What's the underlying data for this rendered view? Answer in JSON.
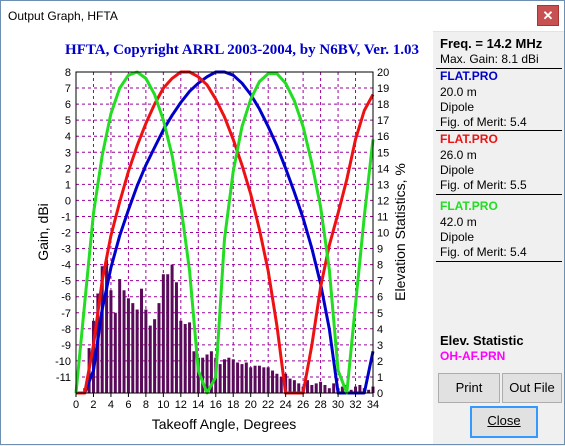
{
  "window": {
    "title": "Output Graph, HFTA"
  },
  "chart_data": {
    "type": "line",
    "title": "HFTA, Copyright ARRL 2003-2004, by N6BV, Ver. 1.03",
    "xlabel": "Takeoff Angle, Degrees",
    "ylabel": "Gain, dBi",
    "y2label": "Elevation Statistics, %",
    "xlim": [
      0,
      34
    ],
    "ylim": [
      -12,
      8
    ],
    "y2lim": [
      0,
      20
    ],
    "xticks": [
      0,
      2,
      4,
      6,
      8,
      10,
      12,
      14,
      16,
      18,
      20,
      22,
      24,
      26,
      28,
      30,
      32,
      34
    ],
    "yticks": [
      8,
      7,
      6,
      5,
      4,
      3,
      2,
      1,
      0,
      -1,
      -2,
      -3,
      -4,
      -5,
      -6,
      -7,
      -8,
      -9,
      -10,
      -11
    ],
    "y2ticks": [
      20,
      19,
      18,
      17,
      16,
      15,
      14,
      13,
      12,
      11,
      10,
      9,
      8,
      7,
      6,
      5,
      4,
      3,
      2,
      1,
      0
    ],
    "grid": true,
    "series": [
      {
        "name": "FLAT.PRO 20.0 m Dipole",
        "color": "#0000cc",
        "x": [
          0,
          1,
          2,
          3,
          4,
          5,
          6,
          7,
          8,
          9,
          10,
          11,
          12,
          13,
          14,
          15,
          16,
          17,
          18,
          19,
          20,
          21,
          22,
          23,
          24,
          25,
          26,
          27,
          28,
          29,
          30,
          31,
          32,
          33,
          34
        ],
        "y": [
          -12,
          -12,
          -10.6,
          -6.8,
          -4.2,
          -2.2,
          -0.6,
          0.9,
          2.2,
          3.3,
          4.4,
          5.3,
          6.1,
          6.8,
          7.3,
          7.7,
          8,
          8,
          7.8,
          7.3,
          6.6,
          5.7,
          4.6,
          3.4,
          2,
          0.5,
          -1.1,
          -3,
          -5.2,
          -8,
          -12,
          -12,
          -12,
          -12,
          -9.4
        ]
      },
      {
        "name": "FLAT.PRO 26.0 m Dipole",
        "color": "#ee1111",
        "x": [
          0,
          1,
          2,
          3,
          4,
          5,
          6,
          7,
          8,
          9,
          10,
          11,
          12,
          13,
          14,
          15,
          16,
          17,
          18,
          19,
          20,
          21,
          22,
          23,
          24,
          25,
          26,
          27,
          28,
          29,
          30,
          31,
          32,
          33,
          34
        ],
        "y": [
          -12,
          -12,
          -9,
          -5,
          -2.2,
          -0.1,
          1.8,
          3.4,
          4.8,
          6,
          7,
          7.6,
          8,
          8,
          7.7,
          7.2,
          6.3,
          5.2,
          3.8,
          2.2,
          0.4,
          -1.8,
          -4.4,
          -7.8,
          -12,
          -12,
          -12,
          -9,
          -5.4,
          -2.8,
          -0.8,
          1.3,
          3.8,
          5.6,
          6.6
        ]
      },
      {
        "name": "FLAT.PRO 42.0 m Dipole",
        "color": "#22dd22",
        "x": [
          0,
          1,
          2,
          3,
          4,
          5,
          6,
          7,
          8,
          9,
          10,
          11,
          12,
          13,
          14,
          15,
          16,
          17,
          18,
          19,
          20,
          21,
          22,
          23,
          24,
          25,
          26,
          27,
          28,
          29,
          30,
          31,
          32,
          33,
          34
        ],
        "y": [
          -12,
          -6.4,
          -0.8,
          2.8,
          5.4,
          7,
          7.8,
          8,
          7.6,
          6.6,
          5,
          2.8,
          -0.3,
          -4.4,
          -10.6,
          -12,
          -11,
          -2.4,
          1.8,
          4.6,
          6.3,
          7.4,
          7.9,
          7.9,
          7.3,
          6.2,
          4.6,
          2.3,
          -0.4,
          -4.3,
          -10.6,
          -12,
          -6.5,
          -1,
          3.8
        ]
      }
    ],
    "bars": {
      "name": "Elevation Statistics",
      "color": "#5a0a5a",
      "x": [
        1,
        1.5,
        2,
        2.5,
        3,
        3.5,
        4,
        4.5,
        5,
        5.5,
        6,
        6.5,
        7,
        7.5,
        8,
        8.5,
        9,
        9.5,
        10,
        10.5,
        11,
        11.5,
        12,
        12.5,
        13,
        13.5,
        14,
        14.5,
        15,
        15.5,
        16,
        16.5,
        17,
        17.5,
        18,
        18.5,
        19,
        19.5,
        20,
        20.5,
        21,
        21.5,
        22,
        22.5,
        23,
        23.5,
        24,
        24.5,
        25,
        25.5,
        26,
        26.5,
        27,
        27.5,
        28,
        28.5,
        29,
        29.5,
        30,
        30.5,
        31,
        31.5,
        32,
        32.5,
        33,
        33.5,
        34
      ],
      "values": [
        0.3,
        2.8,
        4.5,
        6.2,
        7.9,
        8.3,
        6.4,
        5,
        7.1,
        6.4,
        5.9,
        5.6,
        5.2,
        6.5,
        5.2,
        4.2,
        4.6,
        5.6,
        7.4,
        7.4,
        8,
        6.9,
        4.5,
        4.3,
        4.4,
        2.6,
        2.2,
        2.2,
        2.4,
        2.6,
        2.2,
        1.8,
        2.1,
        2.2,
        2.1,
        1.9,
        1.8,
        1.9,
        1.6,
        1.7,
        1.7,
        1.6,
        1.6,
        1.4,
        1.2,
        1.0,
        1.2,
        0.9,
        0.8,
        0.6,
        0.4,
        0.8,
        0.5,
        0.6,
        0.7,
        0.5,
        0.3,
        0.6,
        0.3,
        0.4,
        0.5,
        0.2,
        0.4,
        0.5,
        0.3,
        0.2,
        0.4
      ]
    }
  },
  "panel": {
    "freq": "Freq. = 14.2 MHz",
    "max_gain": "Max. Gain: 8.1 dBi",
    "ants": [
      {
        "file": "FLAT.PRO",
        "height": "20.0 m",
        "type": "Dipole",
        "fom": "Fig. of Merit:  5.4",
        "color": "#0000cc"
      },
      {
        "file": "FLAT.PRO",
        "height": "26.0 m",
        "type": "Dipole",
        "fom": "Fig. of Merit:  5.5",
        "color": "#ee1111"
      },
      {
        "file": "FLAT.PRO",
        "height": "42.0 m",
        "type": "Dipole",
        "fom": "Fig. of Merit:  5.4",
        "color": "#22dd22"
      }
    ],
    "elev_title": "Elev. Statistic",
    "elev_file": "OH-AF.PRN",
    "elev_file_color": "#ff00ff"
  },
  "buttons": {
    "print": "Print",
    "out_file": "Out File",
    "close": "Close"
  }
}
